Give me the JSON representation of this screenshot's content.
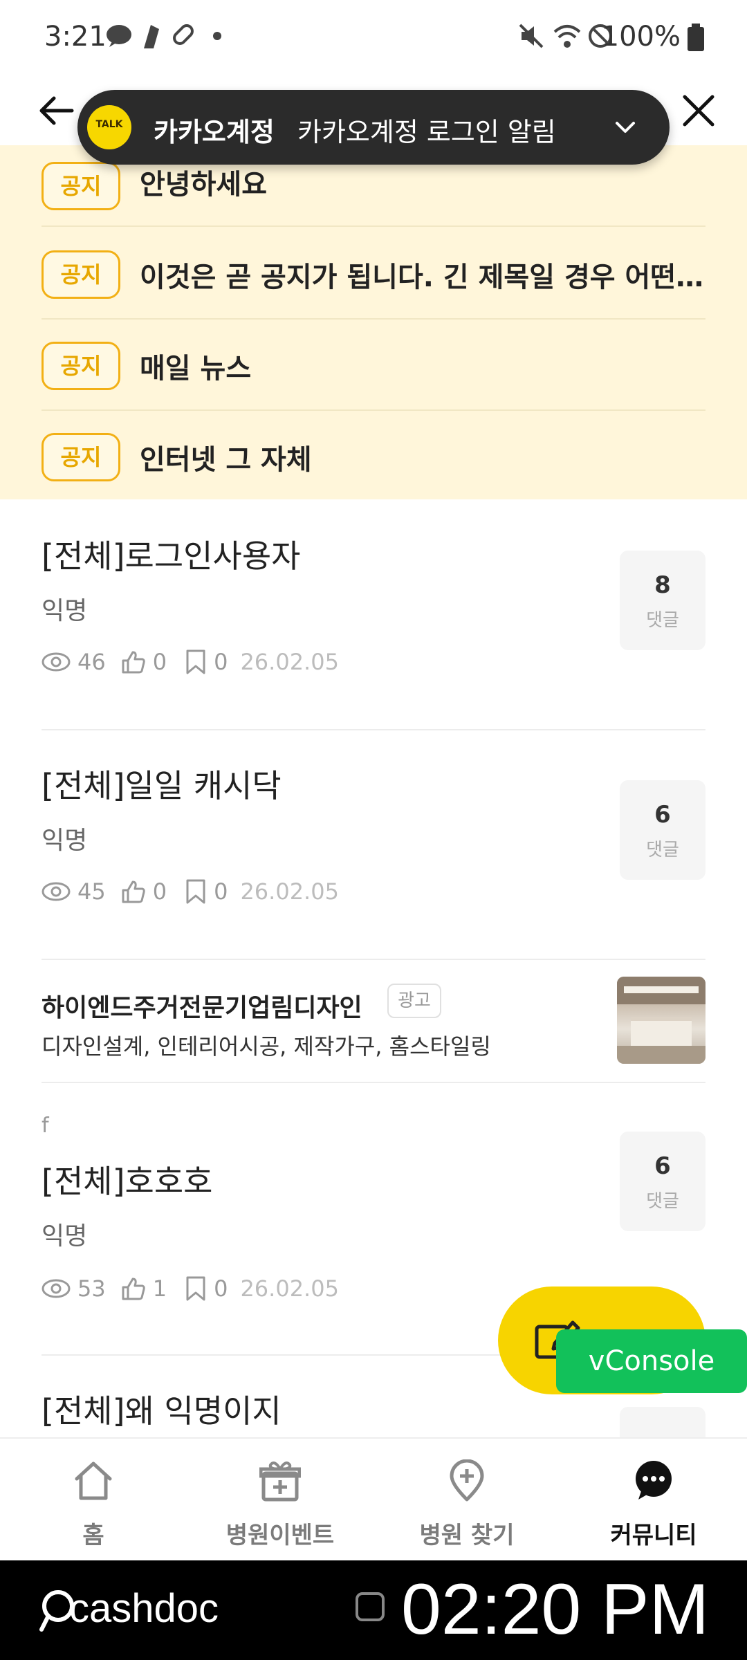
{
  "status_bar": {
    "time": "3:21",
    "battery": "100%"
  },
  "toast": {
    "logo_text": "TALK",
    "app_name": "카카오계정",
    "message": "카카오계정 로그인 알림"
  },
  "notices": [
    {
      "badge": "공지",
      "title": "안녕하세요"
    },
    {
      "badge": "공지",
      "title": "이것은 곧 공지가 됩니다. 긴 제목일 경우 어떤 행..."
    },
    {
      "badge": "공지",
      "title": "매일 뉴스"
    },
    {
      "badge": "공지",
      "title": "인터넷 그 자체"
    }
  ],
  "posts": [
    {
      "category_text": "",
      "title": "[전체]로그인사용자",
      "author": "익명",
      "views": "46",
      "likes": "0",
      "bookmarks": "0",
      "date": "26.02.05",
      "comments": "8",
      "comments_label": "댓글"
    },
    {
      "category_text": "",
      "title": "[전체]일일 캐시닥",
      "author": "익명",
      "views": "45",
      "likes": "0",
      "bookmarks": "0",
      "date": "26.02.05",
      "comments": "6",
      "comments_label": "댓글"
    },
    {
      "category_text": "f",
      "title": "[전체]호호호",
      "author": "익명",
      "views": "53",
      "likes": "1",
      "bookmarks": "0",
      "date": "26.02.05",
      "comments": "6",
      "comments_label": "댓글"
    },
    {
      "category_text": "",
      "title": "[전체]왜 익명이지"
    }
  ],
  "ad": {
    "name": "하이엔드주거전문기업림디자인",
    "tag": "광고",
    "description": "디자인설계, 인테리어시공, 제작가구, 홈스타일링"
  },
  "vconsole": {
    "label": "vConsole"
  },
  "bottom_nav": [
    {
      "label": "홈",
      "icon": "home-icon"
    },
    {
      "label": "병원이벤트",
      "icon": "gift-icon"
    },
    {
      "label": "병원 찾기",
      "icon": "location-pin-icon"
    },
    {
      "label": "커뮤니티",
      "icon": "chat-bubble-icon"
    }
  ],
  "system_bar": {
    "brand": "cashdoc",
    "clock": "02:20 PM"
  },
  "colors": {
    "accent_yellow": "#f7d400",
    "notice_bg": "#fff6da",
    "badge_orange": "#f2b015",
    "vconsole_green": "#12c15a"
  }
}
